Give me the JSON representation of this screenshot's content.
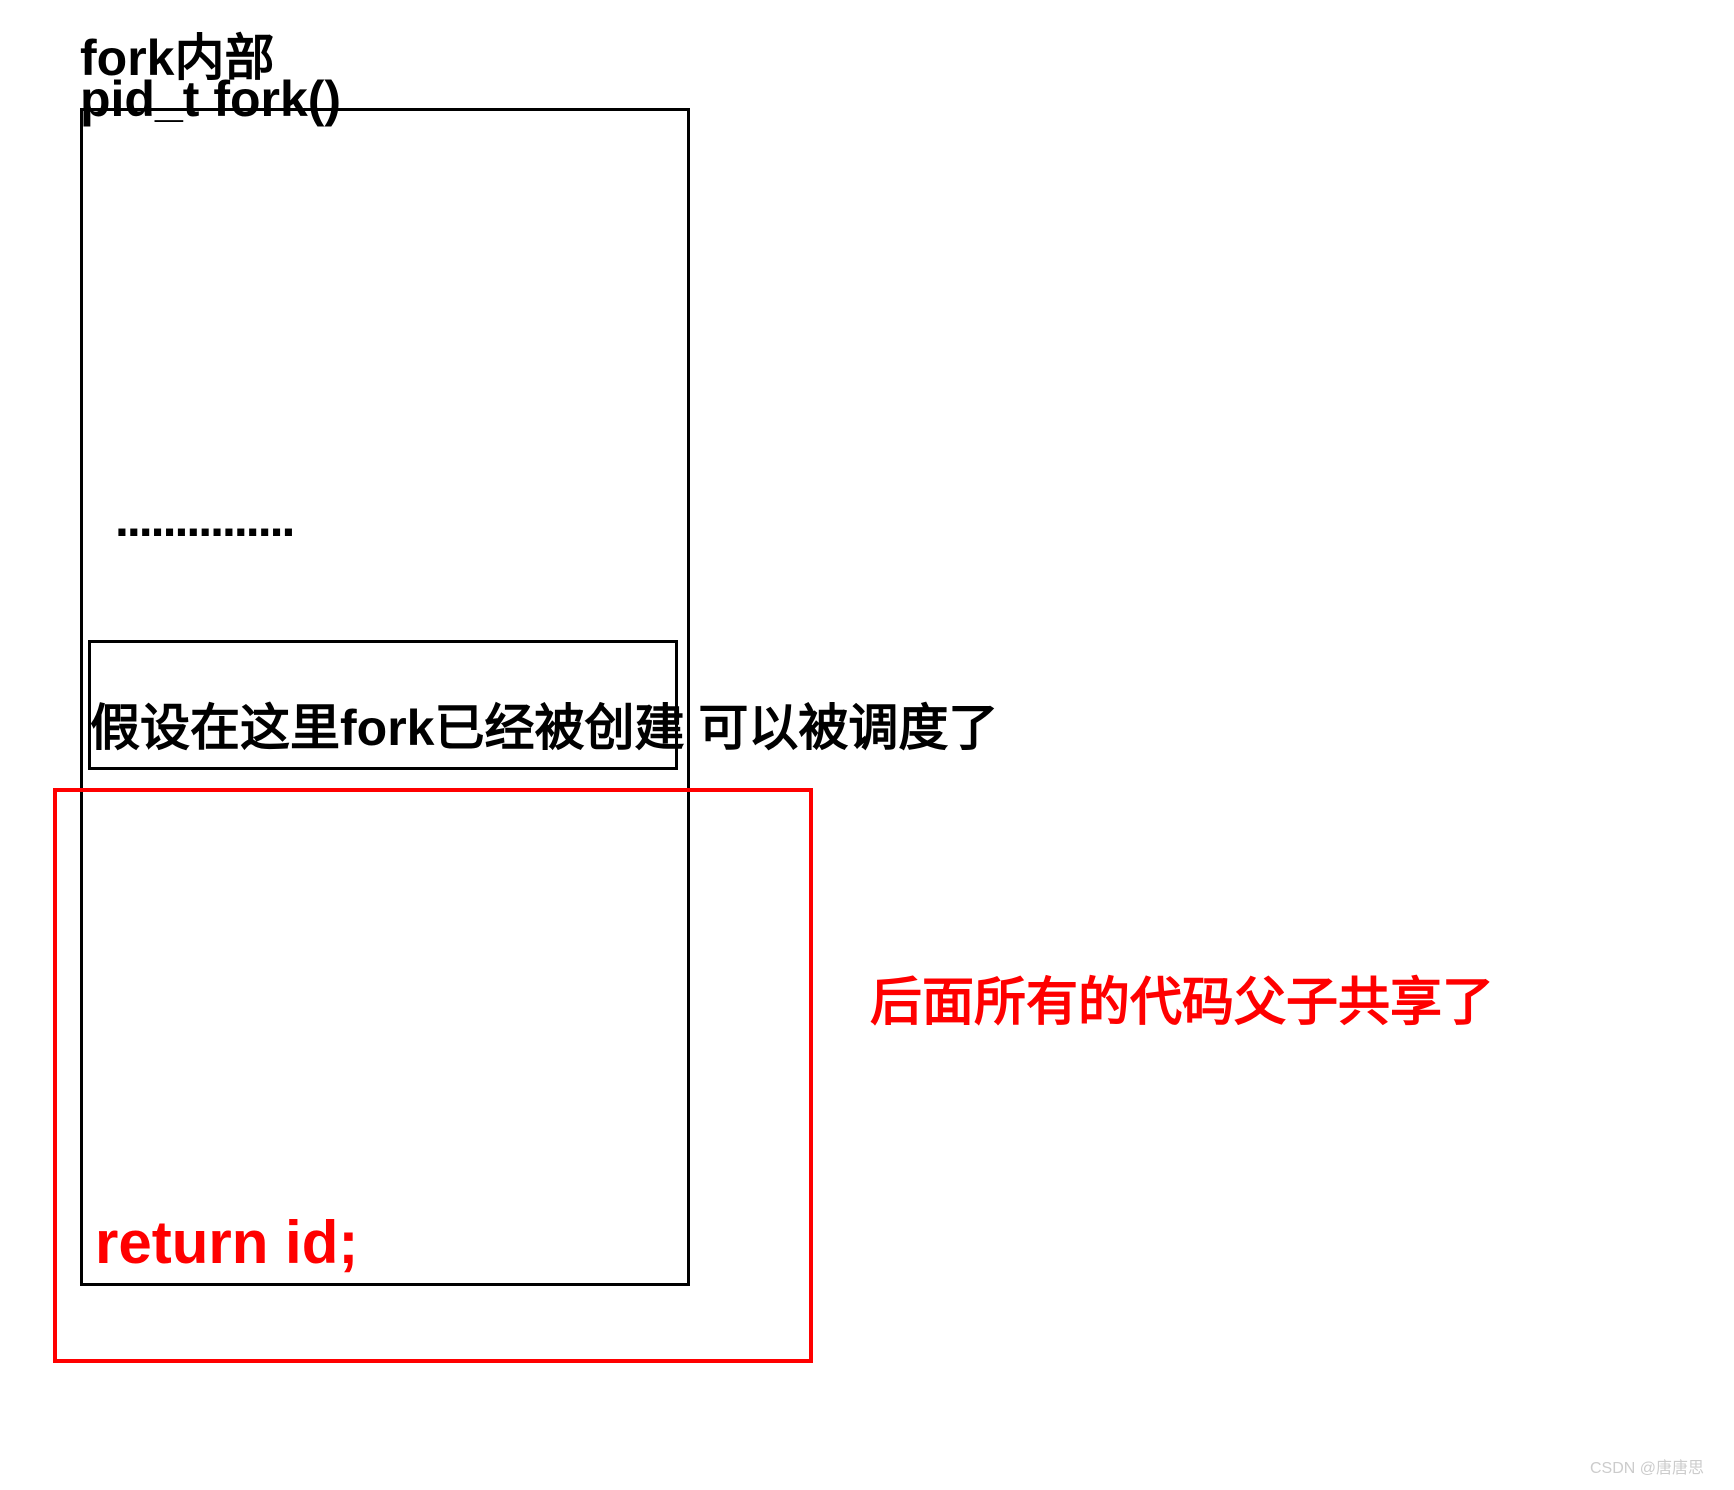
{
  "title": {
    "line1": "fork内部",
    "line2": "pid_t fork()"
  },
  "dots": "...............",
  "assume_text": "假设在这里fork已经被创建 可以被调度了",
  "return_text": "return id;",
  "shared_text": "后面所有的代码父子共享了",
  "watermark": "CSDN @唐唐思"
}
